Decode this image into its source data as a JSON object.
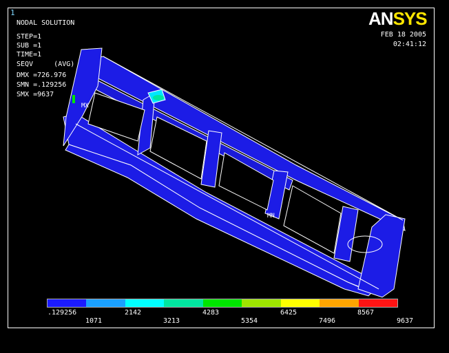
{
  "window_number": "1",
  "header": {
    "title": "NODAL SOLUTION",
    "step": "STEP=1",
    "sub": "SUB =1",
    "time": "TIME=1",
    "seqv": "SEQV     (AVG)",
    "dmx": "DMX =726.976",
    "smn": "SMN =.129256",
    "smx": "SMX =9637"
  },
  "logo": {
    "part1": "AN",
    "part2": "SYS"
  },
  "date": "FEB 18 2005",
  "time_of_day": "02:41:12",
  "model_labels": {
    "mn": "MN",
    "mx": "MX"
  },
  "legend": {
    "colors": [
      "#1b1bff",
      "#1aa0ff",
      "#00ffff",
      "#00e6a0",
      "#00e600",
      "#9ee600",
      "#ffff00",
      "#ffa500",
      "#ff1414"
    ],
    "upper_labels": [
      ".129256",
      "2142",
      "4283",
      "6425",
      "8567"
    ],
    "lower_labels": [
      "1071",
      "3213",
      "5354",
      "7496",
      "9637"
    ]
  }
}
